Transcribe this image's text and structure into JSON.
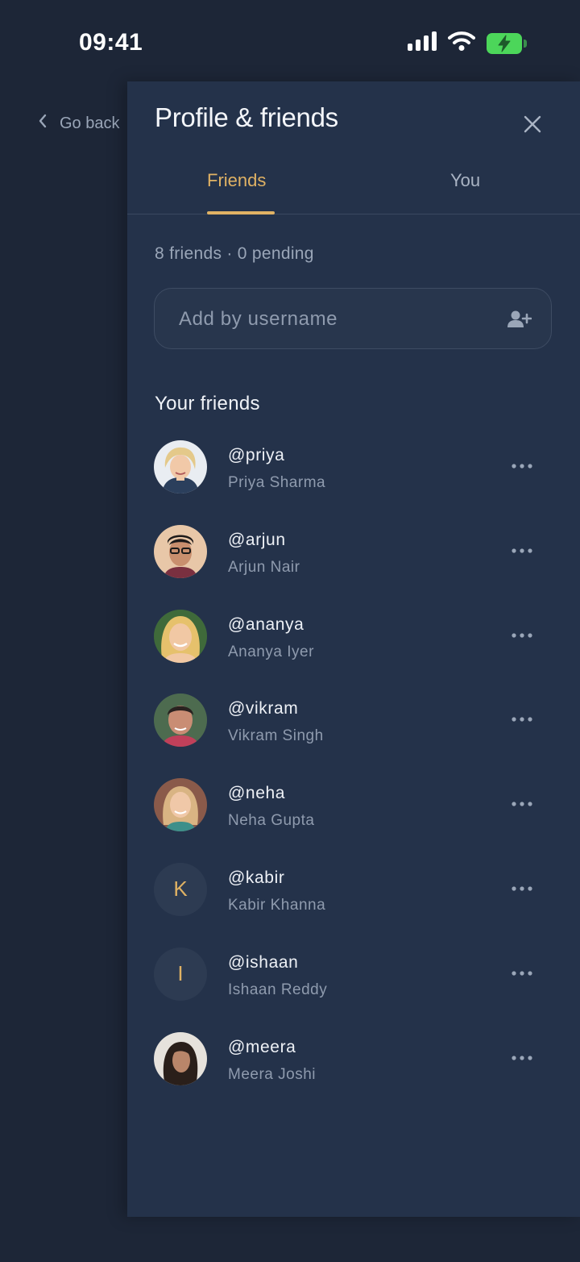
{
  "status": {
    "time": "09:41"
  },
  "nav": {
    "back_label": "Go back"
  },
  "panel": {
    "title": "Profile & friends",
    "tabs": [
      {
        "label": "Friends",
        "active": true
      },
      {
        "label": "You",
        "active": false
      }
    ],
    "counts": "8 friends · 0 pending",
    "search": {
      "placeholder": "Add by username",
      "value": ""
    },
    "section_title": "Your friends",
    "friends": [
      {
        "username": "@priya",
        "name": "Priya Sharma",
        "avatar": "photo"
      },
      {
        "username": "@arjun",
        "name": "Arjun Nair",
        "avatar": "photo"
      },
      {
        "username": "@ananya",
        "name": "Ananya Iyer",
        "avatar": "photo"
      },
      {
        "username": "@vikram",
        "name": "Vikram Singh",
        "avatar": "photo"
      },
      {
        "username": "@neha",
        "name": "Neha Gupta",
        "avatar": "photo"
      },
      {
        "username": "@kabir",
        "name": "Kabir Khanna",
        "avatar": "K"
      },
      {
        "username": "@ishaan",
        "name": "Ishaan Reddy",
        "avatar": "I"
      },
      {
        "username": "@meera",
        "name": "Meera Joshi",
        "avatar": "photo"
      }
    ]
  },
  "colors": {
    "background": "#1d2637",
    "panel": "#24324a",
    "accent": "#e0b264",
    "battery": "#4cd65a"
  },
  "icons": [
    "signal-icon",
    "wifi-icon",
    "battery-icon",
    "chevron-left-icon",
    "close-icon",
    "add-user-icon",
    "more-icon"
  ]
}
